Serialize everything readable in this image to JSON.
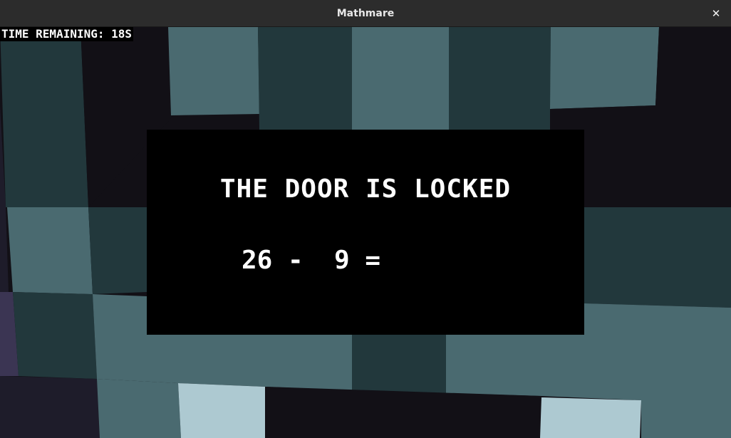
{
  "window": {
    "title": "Mathmare",
    "close_symbol": "✕"
  },
  "hud": {
    "timer_text": "TIME REMAINING: 18S"
  },
  "dialog": {
    "title": "THE DOOR IS LOCKED",
    "equation": "26 -  9 =",
    "answer": ""
  },
  "colors": {
    "titlebar": "#2c2c2c",
    "void": "#121016",
    "tile_light": "#4a6a70",
    "tile_dark": "#22383c",
    "tile_pale": "#adc9d1",
    "tile_purple": "#3b3553",
    "dialog_bg": "#000000",
    "text": "#ffffff"
  }
}
